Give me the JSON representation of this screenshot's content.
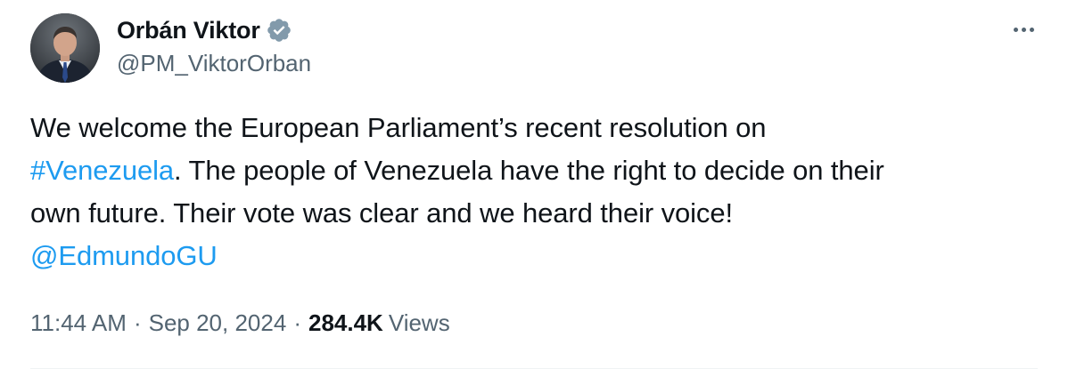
{
  "author": {
    "display_name": "Orbán Viktor",
    "handle": "@PM_ViktorOrban",
    "verified_icon": "verified-badge-icon"
  },
  "tweet": {
    "line1": "We welcome the European Parliament’s recent resolution on",
    "hashtag": "#Venezuela",
    "line2_rest": ". The people of Venezuela have the right to decide on their",
    "line3": "own future. Their vote was clear and we heard their voice!",
    "mention": "@EdmundoGU"
  },
  "meta": {
    "time": "11:44 AM",
    "separator": "·",
    "date": "Sep 20, 2024",
    "views_count": "284.4K",
    "views_label": "Views"
  },
  "colors": {
    "link": "#1d9bf0",
    "secondary_text": "#536471",
    "primary_text": "#0f1419",
    "verified_badge": "#829aab"
  },
  "icons": {
    "more": "more-options-icon"
  }
}
